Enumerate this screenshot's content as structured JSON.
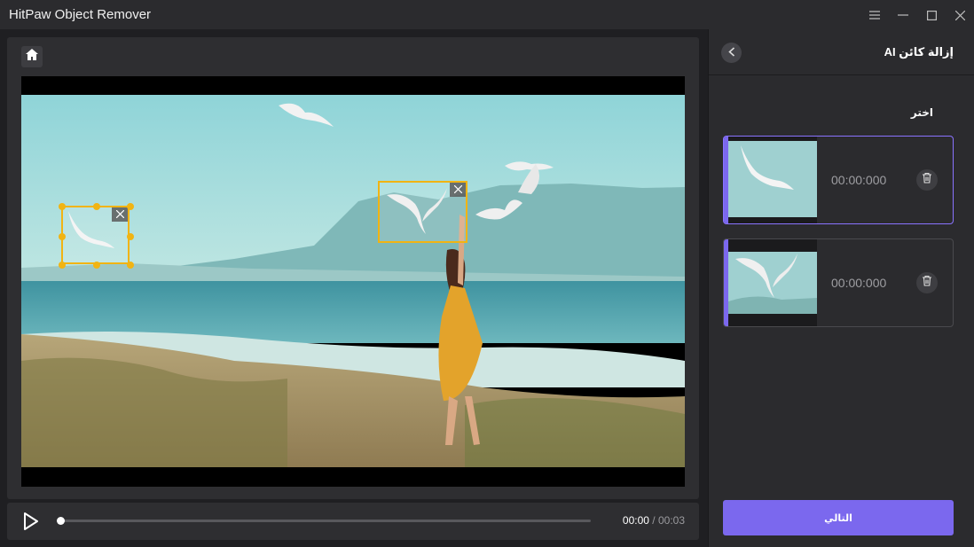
{
  "app": {
    "title": "HitPaw Object Remover"
  },
  "window_controls": {
    "menu_icon": "menu-icon",
    "minimize_icon": "minimize-icon",
    "maximize_icon": "maximize-icon",
    "close_icon": "close-icon"
  },
  "editor": {
    "home_icon": "home-icon",
    "selections": [
      {
        "name": "selection-box-1",
        "close_icon": "close-icon"
      },
      {
        "name": "selection-box-2",
        "close_icon": "close-icon"
      }
    ]
  },
  "playback": {
    "play_icon": "play-icon",
    "progress": 0.0,
    "current_time": "00:00",
    "separator": "/",
    "duration": "00:03"
  },
  "panel": {
    "back_icon": "chevron-left-icon",
    "title": "إزالة كائن AI",
    "select_label": "اختر",
    "items": [
      {
        "time": "00:00:000",
        "selected": true,
        "delete_icon": "trash-icon"
      },
      {
        "time": "00:00:000",
        "selected": false,
        "delete_icon": "trash-icon"
      }
    ],
    "next_label": "التالي"
  },
  "colors": {
    "accent": "#7b68ee",
    "selection": "#f1b413",
    "background": "#1f1f22"
  }
}
